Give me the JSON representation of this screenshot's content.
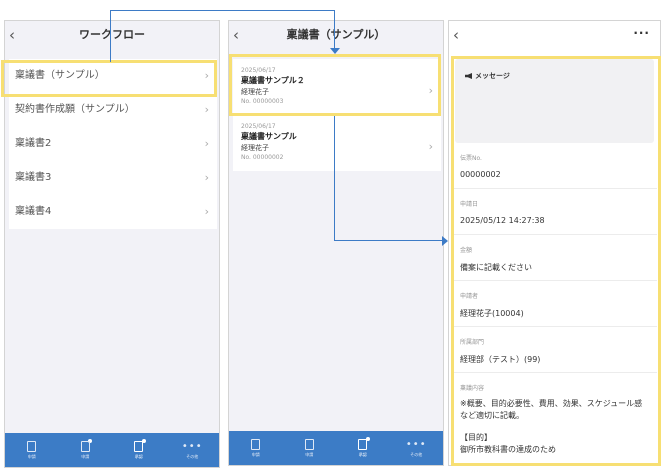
{
  "screen1": {
    "title": "ワークフロー",
    "items": [
      {
        "label": "稟議書（サンプル）"
      },
      {
        "label": "契約書作成願（サンプル）"
      },
      {
        "label": "稟議書2"
      },
      {
        "label": "稟議書3"
      },
      {
        "label": "稟議書4"
      }
    ]
  },
  "screen2": {
    "title": "稟議書（サンプル）",
    "applications": [
      {
        "date": "2025/06/17",
        "title": "稟議書サンプル２",
        "applicant": "経理花子",
        "number": "No. 00000003"
      },
      {
        "date": "2025/06/17",
        "title": "稟議書サンプル",
        "applicant": "経理花子",
        "number": "No. 00000002"
      }
    ]
  },
  "screen3": {
    "more": "···",
    "message_label": "メッセージ",
    "fields": [
      {
        "label": "伝票No.",
        "value": "00000002"
      },
      {
        "label": "申請日",
        "value": "2025/05/12 14:27:38"
      },
      {
        "label": "金額",
        "value": "備案に記載ください"
      },
      {
        "label": "申請者",
        "value": "経理花子(10004)"
      },
      {
        "label": "所属部門",
        "value": "経理部（テスト）(99)"
      }
    ],
    "content": {
      "label": "稟議内容",
      "line1": "※概要、目的必要性、費用、効果、スケジュール感など適切に記載。",
      "line2": "【目的】",
      "line3": "御所市教科書の達成のため"
    }
  },
  "tabbar": {
    "tabs": [
      {
        "label": "申請"
      },
      {
        "label": "申請"
      },
      {
        "label": "承認"
      },
      {
        "label": "その他"
      }
    ]
  },
  "colors": {
    "tabbar": "#3c7cc6",
    "highlight": "#f7df73",
    "arrow": "#3d7bc6"
  }
}
